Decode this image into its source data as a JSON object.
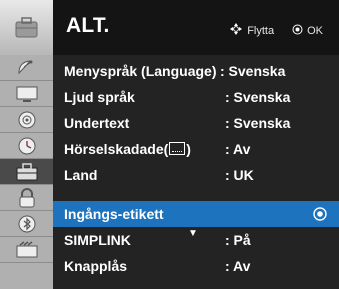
{
  "header": {
    "title": "ALT.",
    "hint_move": "Flytta",
    "hint_ok": "OK"
  },
  "sidebar": {
    "icons": [
      {
        "name": "satellite-dish-icon"
      },
      {
        "name": "picture-screen-icon"
      },
      {
        "name": "audio-speaker-icon"
      },
      {
        "name": "clock-icon"
      },
      {
        "name": "options-suitcase-icon",
        "selected": true
      },
      {
        "name": "lock-icon"
      },
      {
        "name": "bluetooth-icon"
      },
      {
        "name": "input-usb-icon"
      }
    ]
  },
  "menu": {
    "items": [
      {
        "label": "Menyspråk (Language)",
        "value": ": Svenska"
      },
      {
        "label": "Ljud språk",
        "value": ": Svenska"
      },
      {
        "label": "Undertext",
        "value": ": Svenska"
      },
      {
        "label": "Hörselskadade(",
        "label_suffix": ")",
        "value": ": Av"
      },
      {
        "label": "Land",
        "value": ": UK"
      },
      {
        "label": "Ingångs-etikett",
        "value": "",
        "selected": true
      },
      {
        "label": "SIMPLINK",
        "value": ": På"
      },
      {
        "label": "Knapplås",
        "value": ": Av"
      }
    ],
    "scroll_indicator": "▼"
  },
  "colors": {
    "selection": "#1e73be",
    "menu_bg": "#232323",
    "sidebar_bg": "#b0b0b0"
  }
}
